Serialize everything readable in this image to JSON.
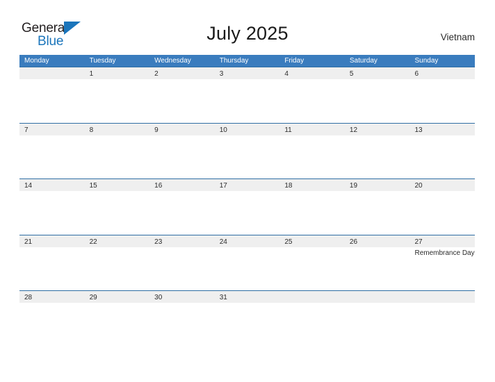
{
  "logo": {
    "word_one": "General",
    "word_two": "Blue",
    "flag_icon": "blue-flag-triangle"
  },
  "header": {
    "title": "July 2025",
    "country": "Vietnam"
  },
  "calendar": {
    "weekdays": [
      "Monday",
      "Tuesday",
      "Wednesday",
      "Thursday",
      "Friday",
      "Saturday",
      "Sunday"
    ],
    "header_bg": "#3a7cbe",
    "band_bg": "#efefef",
    "row_line": "#2e6da4",
    "weeks": [
      [
        {
          "num": "",
          "event": ""
        },
        {
          "num": "1",
          "event": ""
        },
        {
          "num": "2",
          "event": ""
        },
        {
          "num": "3",
          "event": ""
        },
        {
          "num": "4",
          "event": ""
        },
        {
          "num": "5",
          "event": ""
        },
        {
          "num": "6",
          "event": ""
        }
      ],
      [
        {
          "num": "7",
          "event": ""
        },
        {
          "num": "8",
          "event": ""
        },
        {
          "num": "9",
          "event": ""
        },
        {
          "num": "10",
          "event": ""
        },
        {
          "num": "11",
          "event": ""
        },
        {
          "num": "12",
          "event": ""
        },
        {
          "num": "13",
          "event": ""
        }
      ],
      [
        {
          "num": "14",
          "event": ""
        },
        {
          "num": "15",
          "event": ""
        },
        {
          "num": "16",
          "event": ""
        },
        {
          "num": "17",
          "event": ""
        },
        {
          "num": "18",
          "event": ""
        },
        {
          "num": "19",
          "event": ""
        },
        {
          "num": "20",
          "event": ""
        }
      ],
      [
        {
          "num": "21",
          "event": ""
        },
        {
          "num": "22",
          "event": ""
        },
        {
          "num": "23",
          "event": ""
        },
        {
          "num": "24",
          "event": ""
        },
        {
          "num": "25",
          "event": ""
        },
        {
          "num": "26",
          "event": ""
        },
        {
          "num": "27",
          "event": "Remembrance Day"
        }
      ],
      [
        {
          "num": "28",
          "event": ""
        },
        {
          "num": "29",
          "event": ""
        },
        {
          "num": "30",
          "event": ""
        },
        {
          "num": "31",
          "event": ""
        },
        {
          "num": "",
          "event": ""
        },
        {
          "num": "",
          "event": ""
        },
        {
          "num": "",
          "event": ""
        }
      ]
    ]
  }
}
